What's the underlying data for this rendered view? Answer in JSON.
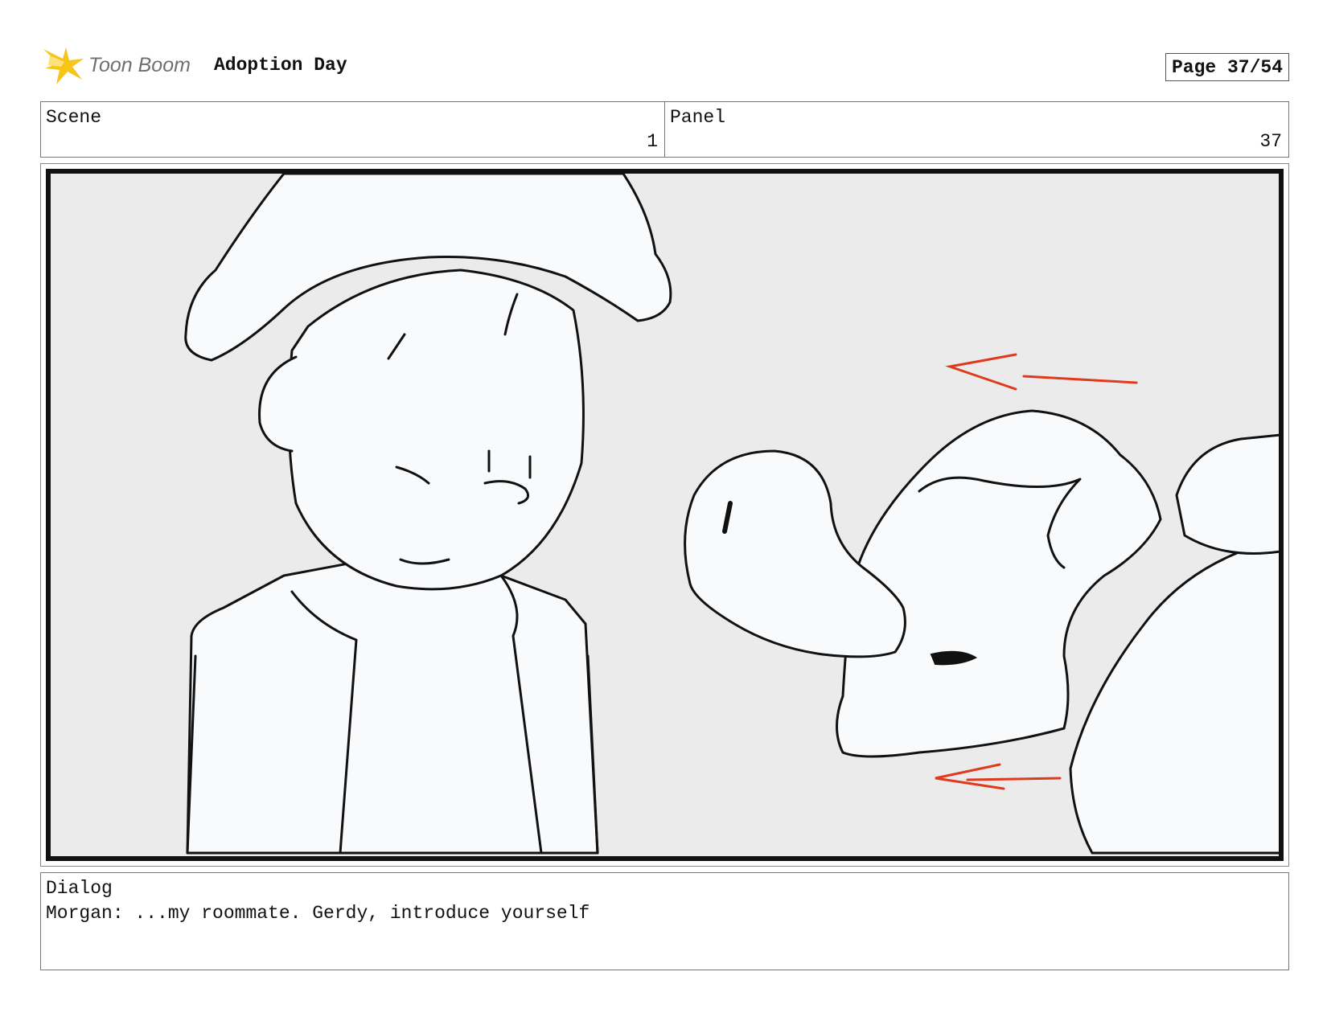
{
  "header": {
    "logo_text": "Toon Boom",
    "title": "Adoption Day",
    "page": "Page 37/54"
  },
  "info": {
    "scene_label": "Scene",
    "scene_value": "1",
    "panel_label": "Panel",
    "panel_value": "37"
  },
  "dialog": {
    "label": "Dialog",
    "text": "Morgan: ...my roommate. Gerdy, introduce yourself"
  },
  "colors": {
    "logo_accent": "#f5c518",
    "motion_arrow": "#e03a1e",
    "panel_background": "#ebebeb",
    "ink": "#111111"
  },
  "icons": {
    "logo": "toon-boom-star-icon",
    "motion": "motion-arrow-icon"
  }
}
